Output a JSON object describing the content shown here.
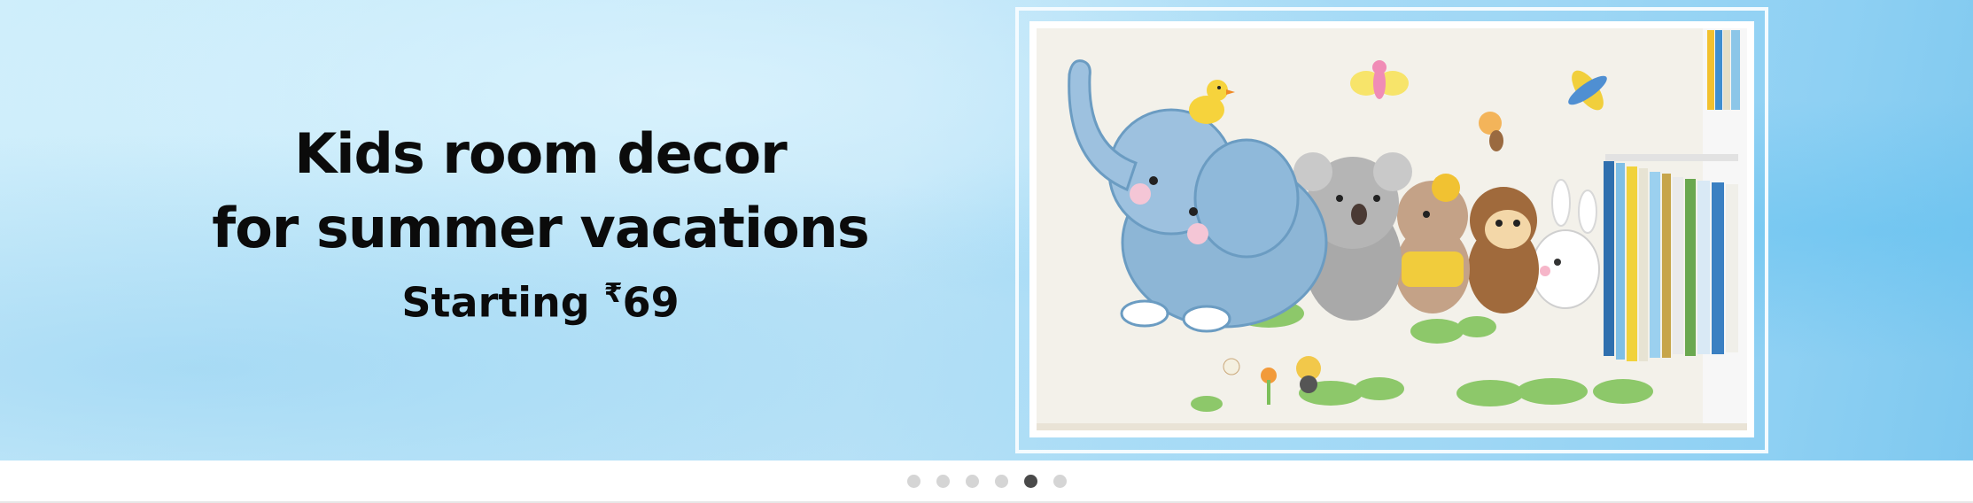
{
  "banner": {
    "headline_line1": "Kids room decor",
    "headline_line2": "for summer vacations",
    "price_prefix": "Starting ",
    "price_currency": "₹",
    "price_value": "69",
    "image_description": "wall-decal-elephant-koala-bear-monkey-bunny"
  },
  "colors": {
    "background_light": "#cfeefb",
    "background_dark": "#7ec8ef",
    "text": "#0b0b0b",
    "dot_active": "#4a4a4a",
    "dot_inactive": "#d5d5d5"
  },
  "carousel": {
    "slide_count": 6,
    "active_index": 4
  }
}
